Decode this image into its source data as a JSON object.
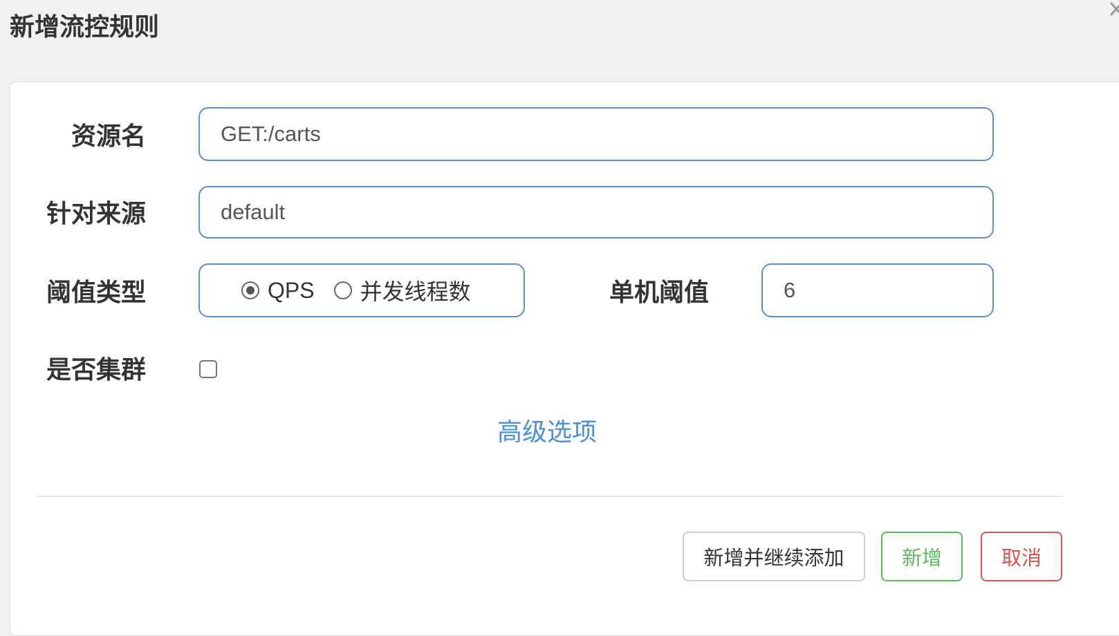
{
  "dialog": {
    "title": "新增流控规则"
  },
  "form": {
    "resource": {
      "label": "资源名",
      "value": "GET:/carts"
    },
    "origin": {
      "label": "针对来源",
      "value": "default"
    },
    "threshold_type": {
      "label": "阈值类型",
      "options": [
        {
          "label": "QPS",
          "selected": true
        },
        {
          "label": "并发线程数",
          "selected": false
        }
      ]
    },
    "single_threshold": {
      "label": "单机阈值",
      "value": "6"
    },
    "cluster": {
      "label": "是否集群",
      "checked": false
    },
    "advanced_label": "高级选项"
  },
  "footer": {
    "continue_label": "新增并继续添加",
    "add_label": "新增",
    "cancel_label": "取消"
  },
  "colors": {
    "field_border": "#5b8fd0",
    "link": "#4a90d9",
    "success": "#5cb85c",
    "danger": "#d9534f"
  }
}
